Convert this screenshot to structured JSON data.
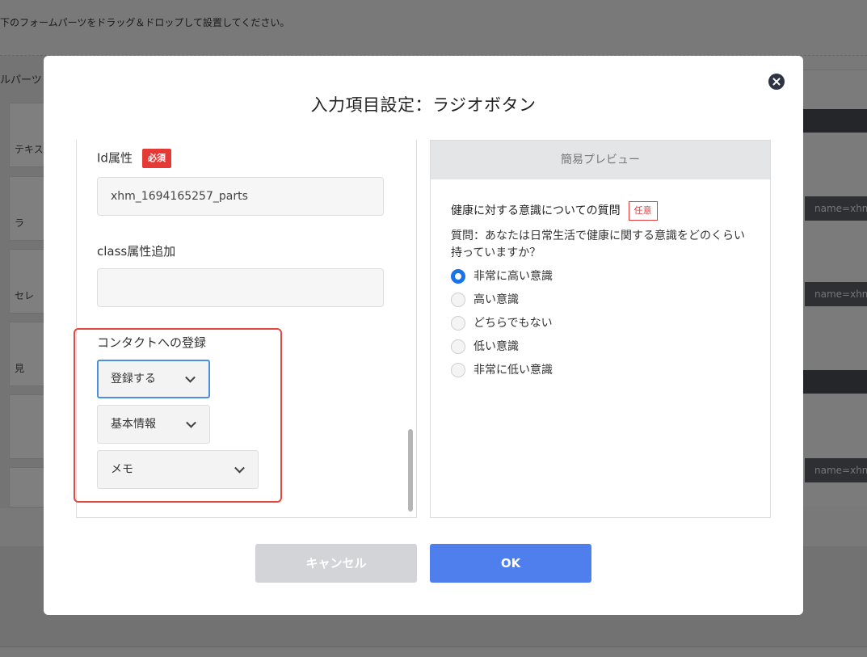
{
  "background": {
    "instruction": "下のフォームパーツをドラッグ＆ドロップして設置してください。",
    "left_panel_title": "ルパーツ",
    "parts": [
      "テキス",
      "ラ",
      "セレ",
      "見",
      "",
      ""
    ],
    "name_pills": [
      "name=xhm",
      "name=xhm",
      "name=xhm"
    ]
  },
  "modal": {
    "title": "入力項目設定：ラジオボタン",
    "close_icon": "close-circle-icon",
    "settings": {
      "id_label": "Id属性",
      "id_required_badge": "必須",
      "id_value": "xhm_1694165257_parts",
      "class_label": "class属性追加",
      "class_value": "",
      "contact_label": "コンタクトへの登録",
      "register_select": "登録する",
      "category_select": "基本情報",
      "field_select": "メモ"
    },
    "preview": {
      "header": "簡易プレビュー",
      "question": "健康に対する意識についての質問",
      "optional_badge": "任意",
      "description": "質問：あなたは日常生活で健康に関する意識をどのくらい持っていますか？",
      "options": [
        {
          "label": "非常に高い意識",
          "checked": true
        },
        {
          "label": "高い意識",
          "checked": false
        },
        {
          "label": "どちらでもない",
          "checked": false
        },
        {
          "label": "低い意識",
          "checked": false
        },
        {
          "label": "非常に低い意識",
          "checked": false
        }
      ]
    },
    "buttons": {
      "cancel": "キャンセル",
      "ok": "OK"
    }
  },
  "colors": {
    "primary": "#4f7fec",
    "radio_checked": "#1a73e8",
    "required": "#e53935",
    "highlight": "#e4473f",
    "cancel_bg": "#d3d4d8"
  }
}
